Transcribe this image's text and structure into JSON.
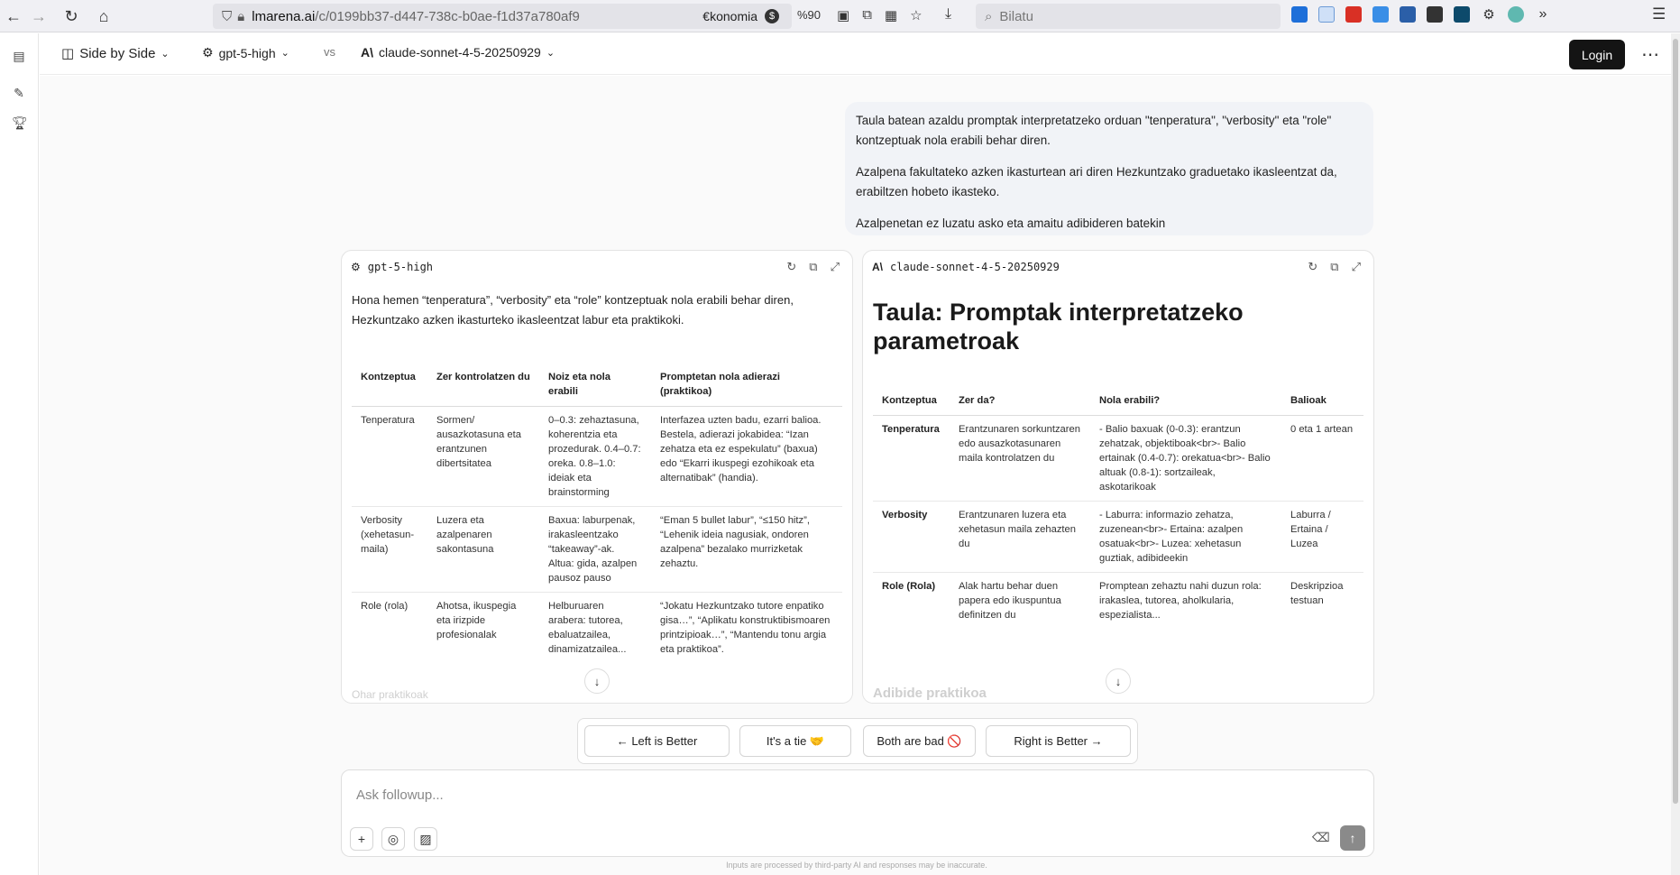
{
  "browser": {
    "url_host": "lmarena.ai",
    "url_path": "/c/0199bb37-d447-738c-b0ae-f1d37a780af9",
    "extension_label": "€konomia",
    "zoom": "%90",
    "search_placeholder": "Bilatu"
  },
  "header": {
    "mode_label": "Side by Side",
    "model_a": "gpt-5-high",
    "vs_label": "vs",
    "model_b": "claude-sonnet-4-5-20250929",
    "login_label": "Login"
  },
  "user_message": {
    "p1": "Taula batean azaldu promptak interpretatzeko orduan \"tenperatura\", \"verbosity\" eta \"role\" kontzeptuak nola erabili behar diren.",
    "p2": "Azalpena fakultateko azken ikasturtean ari diren Hezkuntzako graduetako ikasleentzat da, erabiltzen hobeto ikasteko.",
    "p3": "Azalpenetan ez luzatu asko eta amaitu adibideren batekin"
  },
  "left_panel": {
    "model": "gpt-5-high",
    "intro": "Hona hemen “tenperatura”, “verbosity” eta “role” kontzeptuak nola erabili behar diren, Hezkuntzako azken ikasturteko ikasleentzat labur eta praktikoki.",
    "table": {
      "headers": [
        "Kontzeptua",
        "Zer kontrolatzen du",
        "Noiz eta nola erabili",
        "Promptetan nola adierazi (praktikoa)"
      ],
      "rows": [
        [
          "Tenperatura",
          "Sormen/ ausazkotasuna eta erantzunen dibertsitatea",
          "0–0.3: zehaztasuna, koherentzia eta prozedurak. 0.4–0.7: oreka. 0.8–1.0: ideiak eta brainstorming",
          "Interfazea uzten badu, ezarri balioa. Bestela, adierazi jokabidea: “Izan zehatza eta ez espekulatu” (baxua) edo “Ekarri ikuspegi ezohikoak eta alternatibak” (handia)."
        ],
        [
          "Verbosity (xehetasun-maila)",
          "Luzera eta azalpenaren sakontasuna",
          "Baxua: laburpenak, irakasleentzako “takeaway”-ak. Altua: gida, azalpen pausoz pauso",
          "“Eman 5 bullet labur”, “≤150 hitz”, “Lehenik ideia nagusiak, ondoren azalpena” bezalako murrizketak zehaztu."
        ],
        [
          "Role (rola)",
          "Ahotsa, ikuspegia eta irizpide profesionalak",
          "Helburuaren arabera: tutorea, ebaluatzailea, dinamizatzailea...",
          "“Jokatu Hezkuntzako tutore enpatiko gisa…”, “Aplikatu konstruktibismoaren printzipioak…”, “Mantendu tonu argia eta praktikoa”."
        ]
      ]
    },
    "faded_text": "Ohar praktikoak"
  },
  "right_panel": {
    "model": "claude-sonnet-4-5-20250929",
    "title": "Taula: Promptak interpretatzeko parametroak",
    "table": {
      "headers": [
        "Kontzeptua",
        "Zer da?",
        "Nola erabili?",
        "Balioak"
      ],
      "rows": [
        [
          "Tenperatura",
          "Erantzunaren sorkuntzaren edo ausazkotasunaren maila kontrolatzen du",
          "- Balio baxuak (0-0.3): erantzun zehatzak, objektiboak<br>- Balio ertainak (0.4-0.7): orekatua<br>- Balio altuak (0.8-1): sortzaileak, askotarikoak",
          "0 eta 1 artean"
        ],
        [
          "Verbosity",
          "Erantzunaren luzera eta xehetasun maila zehazten du",
          "- Laburra: informazio zehatza, zuzenean<br>- Ertaina: azalpen osatuak<br>- Luzea: xehetasun guztiak, adibideekin",
          "Laburra / Ertaina / Luzea"
        ],
        [
          "Role (Rola)",
          "Alak hartu behar duen papera edo ikuspuntua definitzen du",
          "Promptean zehaztu nahi duzun rola: irakaslea, tutorea, aholkularia, espezialista...",
          "Deskripzioa testuan"
        ]
      ]
    },
    "faded_text": "Adibide praktikoa"
  },
  "vote": {
    "left": "← Left is Better",
    "tie": "It's a tie 🤝",
    "bad": "Both are bad 🚫",
    "right": "Right is Better →"
  },
  "composer": {
    "placeholder": "Ask followup..."
  },
  "disclaimer": "Inputs are processed by third-party AI and responses may be inaccurate."
}
